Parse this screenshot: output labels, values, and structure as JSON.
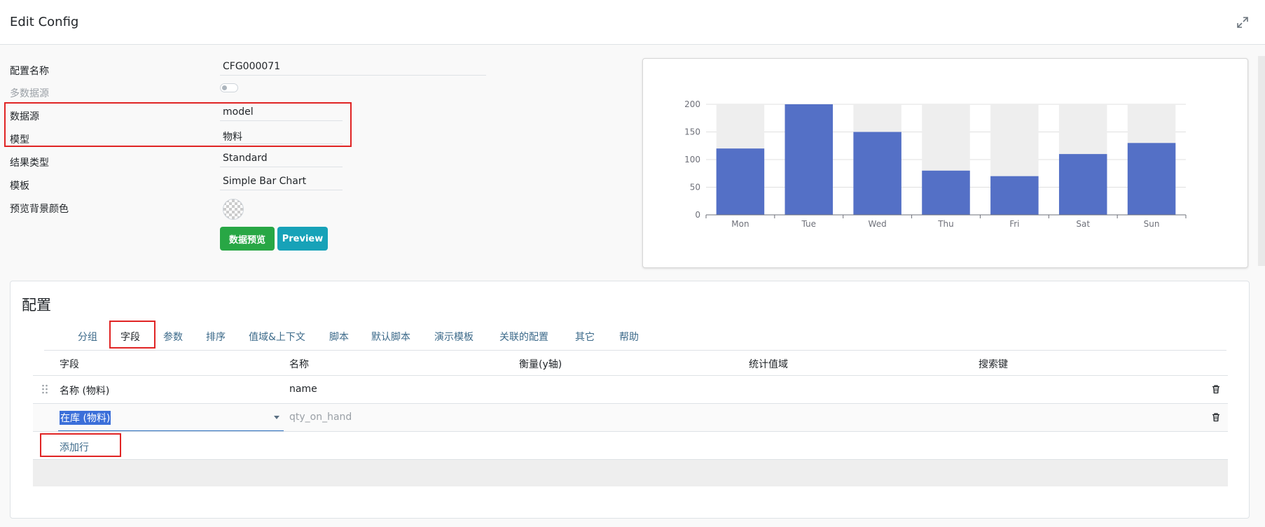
{
  "header": {
    "title": "Edit Config",
    "expand_icon": "expand-icon"
  },
  "form": {
    "fields": [
      {
        "label": "配置名称",
        "value": "CFG000071"
      },
      {
        "label": "多数据源",
        "value": ""
      },
      {
        "label": "数据源",
        "value": "model"
      },
      {
        "label": "模型",
        "value": "物料"
      },
      {
        "label": "结果类型",
        "value": "Standard"
      },
      {
        "label": "模板",
        "value": "Simple Bar Chart"
      },
      {
        "label": "预览背景颜色",
        "value": ""
      }
    ],
    "buttons": {
      "data_preview": "数据预览",
      "preview": "Preview"
    }
  },
  "chart_data": {
    "type": "bar",
    "categories": [
      "Mon",
      "Tue",
      "Wed",
      "Thu",
      "Fri",
      "Sat",
      "Sun"
    ],
    "values": [
      120,
      200,
      150,
      80,
      70,
      110,
      130
    ],
    "ylim": [
      0,
      200
    ],
    "yticks": [
      0,
      50,
      100,
      150,
      200
    ],
    "bar_color": "#5470c6",
    "background_bar_color": "#eeeeee",
    "grid": true,
    "title": "",
    "xlabel": "",
    "ylabel": ""
  },
  "config": {
    "title": "配置",
    "tabs": [
      "分组",
      "字段",
      "参数",
      "排序",
      "值域&上下文",
      "脚本",
      "默认脚本",
      "演示模板",
      "关联的配置",
      "其它",
      "帮助"
    ],
    "active_tab": "字段",
    "columns": [
      "字段",
      "名称",
      "衡量(y轴)",
      "统计值域",
      "搜索键"
    ],
    "rows": [
      {
        "field": "名称 (物料)",
        "name": "name"
      },
      {
        "field": "在库 (物料)",
        "name": "qty_on_hand"
      }
    ],
    "add_row": "添加行"
  }
}
